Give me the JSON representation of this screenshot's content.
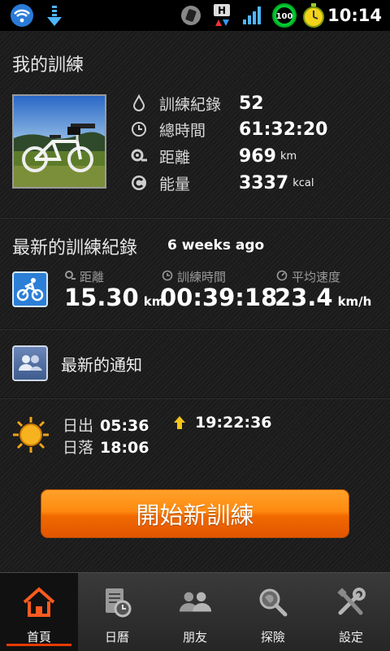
{
  "status_bar": {
    "time": "10:14",
    "battery_level": "100",
    "network_label": "H"
  },
  "profile": {
    "title": "我的訓練",
    "stats": [
      {
        "icon": "drop-icon",
        "label": "訓練紀錄",
        "value": "52",
        "unit": ""
      },
      {
        "icon": "clock-icon",
        "label": "總時間",
        "value": "61:32:20",
        "unit": ""
      },
      {
        "icon": "distance-icon",
        "label": "距離",
        "value": "969",
        "unit": "km"
      },
      {
        "icon": "energy-icon",
        "label": "能量",
        "value": "3337",
        "unit": "kcal"
      }
    ]
  },
  "latest": {
    "title": "最新的訓練紀錄",
    "ago": "6 weeks ago",
    "metrics": [
      {
        "label": "距離",
        "value": "15.30",
        "unit": "km"
      },
      {
        "label": "訓練時間",
        "value": "00:39:18",
        "unit": ""
      },
      {
        "label": "平均速度",
        "value": "23.4",
        "unit": "km/h"
      }
    ]
  },
  "notifications": {
    "label": "最新的通知"
  },
  "sun": {
    "sunrise_label": "日出",
    "sunrise_time": "05:36",
    "sunset_label": "日落",
    "sunset_time": "18:06",
    "daylight": "19:22:36"
  },
  "start_button": "開始新訓練",
  "nav": {
    "tabs": [
      {
        "label": "首頁",
        "icon": "home-icon",
        "active": true
      },
      {
        "label": "日曆",
        "icon": "calendar-icon",
        "active": false
      },
      {
        "label": "朋友",
        "icon": "friends-icon",
        "active": false
      },
      {
        "label": "探險",
        "icon": "explore-icon",
        "active": false
      },
      {
        "label": "設定",
        "icon": "settings-icon",
        "active": false
      }
    ]
  },
  "colors": {
    "accent": "#ff8a10",
    "active_tab_bar": "#e63a00",
    "sport_icon_bg": "#2b7fd6"
  }
}
